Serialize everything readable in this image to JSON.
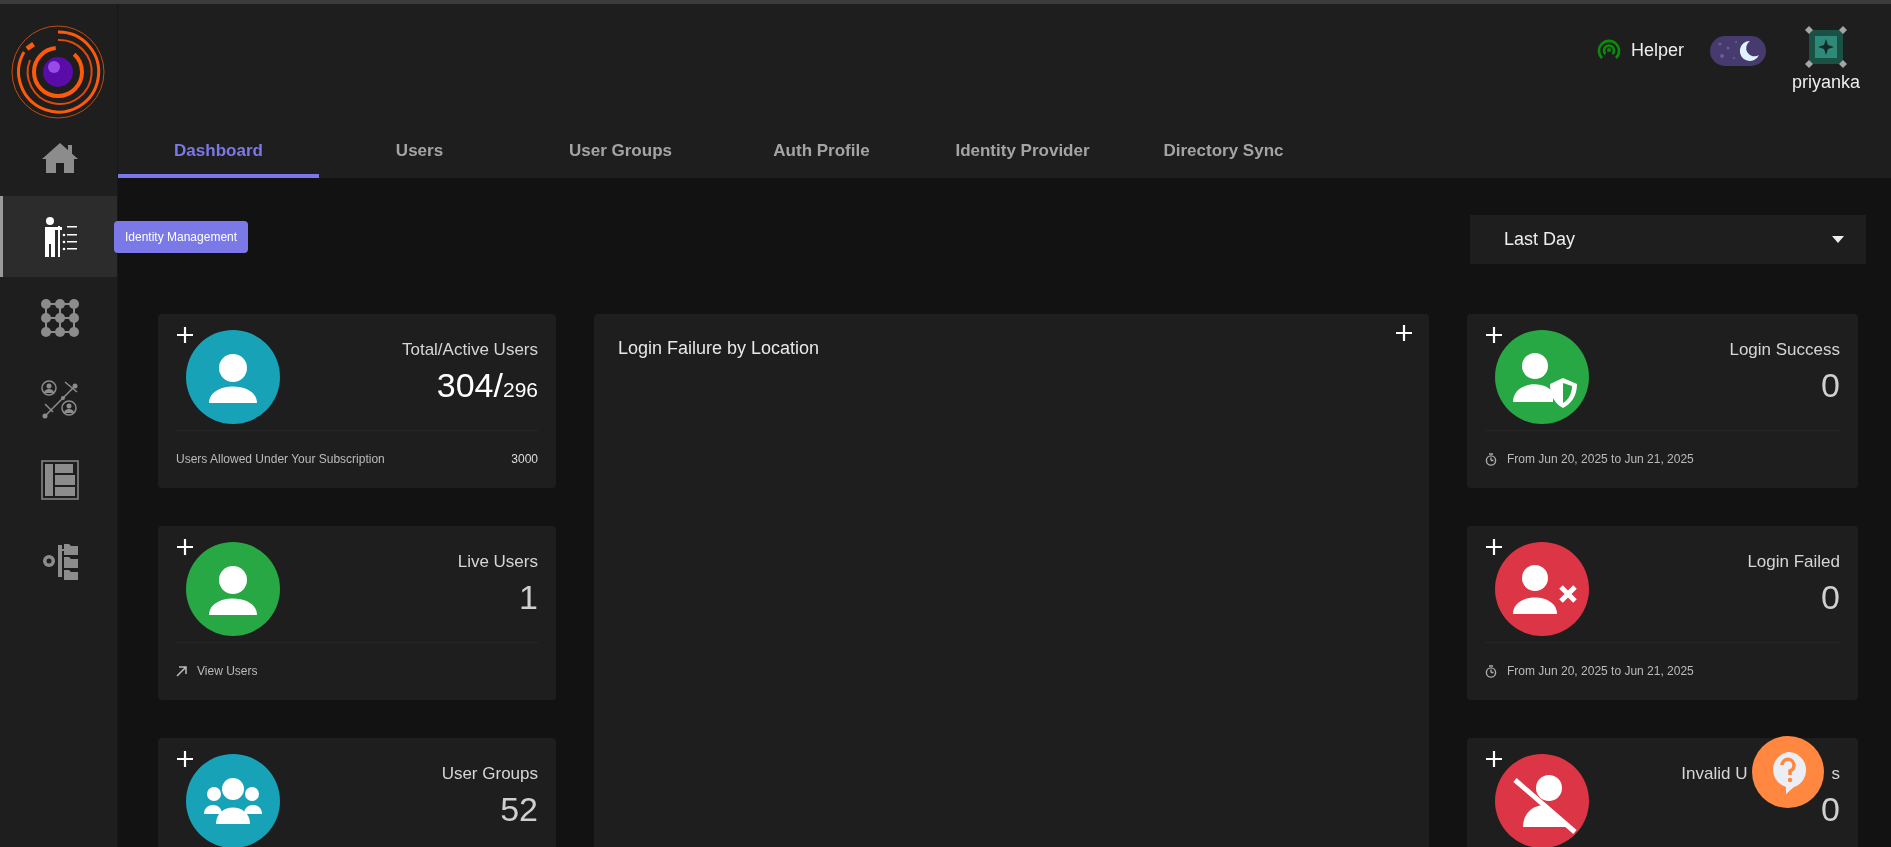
{
  "sidebar": {
    "items": [
      {
        "selected": false
      },
      {
        "selected": true,
        "tooltip": "Identity Management"
      },
      {
        "selected": false
      },
      {
        "selected": false
      },
      {
        "selected": false
      },
      {
        "selected": false
      }
    ]
  },
  "header": {
    "helper": {
      "label": "Helper"
    },
    "theme_toggle": {
      "on": true
    },
    "user": {
      "name": "priyanka"
    }
  },
  "tabs": [
    {
      "label": "Dashboard",
      "selected": true
    },
    {
      "label": "Users",
      "selected": false
    },
    {
      "label": "User Groups",
      "selected": false
    },
    {
      "label": "Auth Profile",
      "selected": false
    },
    {
      "label": "Identity Provider",
      "selected": false
    },
    {
      "label": "Directory Sync",
      "selected": false
    }
  ],
  "period_select": {
    "value": "Last Day"
  },
  "left_cards": [
    {
      "title": "Total/Active Users",
      "value": "304/",
      "value_secondary": "296",
      "color": "#17a2b8",
      "footer": {
        "kind": "quota",
        "label": "Users Allowed Under Your Subscription",
        "value": "3000"
      }
    },
    {
      "title": "Live Users",
      "value": "1",
      "color": "#28a745",
      "footer": {
        "kind": "link",
        "label": "View Users"
      }
    },
    {
      "title": "User Groups",
      "value": "52",
      "color": "#17a2b8"
    }
  ],
  "map_panel": {
    "title": "Login Failure by Location"
  },
  "right_cards": [
    {
      "title": "Login Success",
      "value": "0",
      "color": "#28a745",
      "footer": {
        "kind": "period",
        "label": "From Jun 20, 2025 to Jun 21, 2025"
      }
    },
    {
      "title": "Login Failed",
      "value": "0",
      "color": "#dc3545",
      "footer": {
        "kind": "period",
        "label": "From Jun 20, 2025 to Jun 21, 2025"
      }
    },
    {
      "title": "Invalid U",
      "title_end": "s",
      "value": "0",
      "color": "#dc3545"
    }
  ]
}
